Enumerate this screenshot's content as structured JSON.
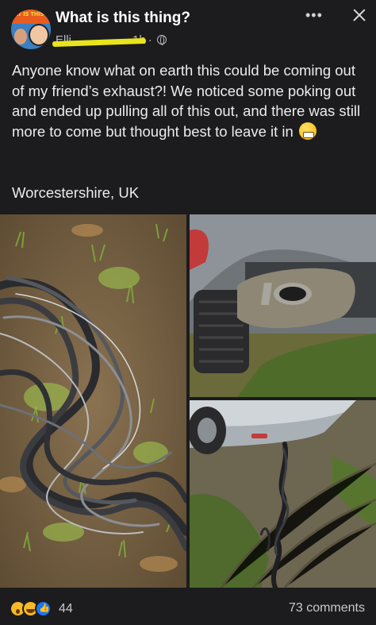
{
  "header": {
    "group_title": "What is this thing?",
    "avatar_badge_text": "AT IS THIS T",
    "author_name": "Elli",
    "post_time": "1h",
    "separator": "·",
    "more_icon": "more-dots-icon",
    "close_icon": "close-icon",
    "globe_icon": "globe-icon"
  },
  "post": {
    "text": "Anyone know what on earth this could be coming out of my friend’s exhaust?! We noticed some poking out and ended up pulling all of this out, and there was still more to come but thought best to leave it in",
    "emoji": "grimacing-face",
    "location": "Worcestershire, UK"
  },
  "photos": [
    {
      "name": "hair-pile-on-ground"
    },
    {
      "name": "car-exhaust-pipe"
    },
    {
      "name": "hair-trailing-from-car"
    }
  ],
  "footer": {
    "reaction_icons": [
      "wow-reaction-icon",
      "haha-reaction-icon",
      "like-reaction-icon"
    ],
    "reaction_count": "44",
    "comments": "73 comments"
  },
  "colors": {
    "background": "#1c1c1e",
    "text": "#ececee",
    "muted": "#b8b9bd",
    "highlight": "#e8e51c",
    "like_blue": "#1877f2",
    "reaction_yellow": "#f7b928"
  }
}
